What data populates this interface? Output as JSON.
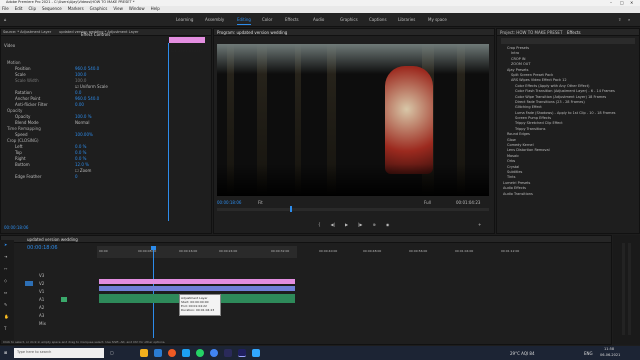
{
  "title": "Adobe Premiere Pro 2021 - C:\\Users\\Ajay\\Videos\\HOW TO MAKE PRESET *",
  "menu": [
    "File",
    "Edit",
    "Clip",
    "Sequence",
    "Markers",
    "Graphics",
    "View",
    "Window",
    "Help"
  ],
  "workspaces": [
    "Learning",
    "Assembly",
    "Editing",
    "Color",
    "Effects",
    "Audio",
    "Graphics",
    "Captions",
    "Libraries",
    "My space"
  ],
  "active_workspace": "Editing",
  "effect_controls": {
    "source_tab": "Source: * Adjustment Layer",
    "seq_tab": "updated version wedding * Adjustment Layer",
    "tab": "Effect Controls",
    "clip_label": "Adjustment Layer",
    "section": "Video",
    "rows": [
      {
        "label": "Motion",
        "value": ""
      },
      {
        "label": "Position",
        "value": "960.0   540.0"
      },
      {
        "label": "Scale",
        "value": "100.0"
      },
      {
        "label": "Scale Width",
        "value": "100.0"
      },
      {
        "label": "",
        "value": "Uniform Scale"
      },
      {
        "label": "Rotation",
        "value": "0.0"
      },
      {
        "label": "Anchor Point",
        "value": "960.0   540.0"
      },
      {
        "label": "Anti-flicker Filter",
        "value": "0.00"
      },
      {
        "label": "Opacity",
        "value": ""
      },
      {
        "label": "Opacity",
        "value": "100.0 %"
      },
      {
        "label": "Blend Mode",
        "value": "Normal"
      },
      {
        "label": "Time Remapping",
        "value": ""
      },
      {
        "label": "Speed",
        "value": "100.00%"
      },
      {
        "label": "Crop (CLOSING)",
        "value": ""
      },
      {
        "label": "Left",
        "value": "0.0 %"
      },
      {
        "label": "Top",
        "value": "0.0 %"
      },
      {
        "label": "Right",
        "value": "0.0 %"
      },
      {
        "label": "Bottom",
        "value": "12.0 %"
      },
      {
        "label": "",
        "value": "Zoom"
      },
      {
        "label": "Edge Feather",
        "value": "0"
      }
    ],
    "timecode": "00:00:18:06"
  },
  "program": {
    "tab": "Program: updated version wedding",
    "timecode": "00:00:18:06",
    "fit": "Fit",
    "quality": "Full",
    "duration": "00:01:04:23"
  },
  "project": {
    "tab": "Project: HOW TO MAKE PRESET",
    "effects_tab": "Effects",
    "items": [
      "Crop Presets",
      "Intro",
      "CROP IN",
      "ZOOM OUT",
      "Ajay Presets",
      "Split Screen Preset Pack",
      "ARS Wipes Video Effect Pack 12",
      "Color Effects (Apply with Any Other Effect)",
      "Color Flash Transition (Adjustment Layer) - 6 - 14 Frames",
      "Color Wipe Transition (Adjustment Layer) 18 Frames",
      "Direct Fade Transitions (23 - 28 Frames)",
      "Glitching Effect",
      "Luma Fade (Shadows) - Apply to 1st Clip - 10 - 18 Frames",
      "Screen Pump Effects",
      "Trippy Stretched Clip Effect",
      "Trippy Transitions",
      "Round Edges",
      "Glow",
      "Comedy Kernel",
      "Lens Distortion Removal",
      "Mosaic",
      "Orbs",
      "Crystal",
      "Subtitles",
      "Tints",
      "Lumetri Presets",
      "Audio Effects",
      "Audio Transitions"
    ]
  },
  "timeline": {
    "tab": "updated version wedding",
    "timecode": "00:00:18:06",
    "ruler": [
      "00:00",
      "00:00:08:00",
      "00:00:16:00",
      "00:00:24:00",
      "00:00:32:00",
      "00:00:40:00",
      "00:00:48:00",
      "00:00:56:00",
      "00:01:04:00",
      "00:01:12:00"
    ],
    "tracks": [
      "V3",
      "V2",
      "V1",
      "A1",
      "A2",
      "A3",
      "Mix"
    ],
    "clip_adjustment": "Adjustment Layer",
    "clip_video": "updated version wedding.mp4 [V]",
    "tooltip": [
      "Adjustment Layer",
      "Start: 00:00:00:00",
      "End: 00:01:04:22",
      "Duration: 00:01:04:23"
    ],
    "status": "Click to select, or click in empty space and drag to marquee select. Use Shift, Alt, and Ctrl for other options."
  },
  "taskbar": {
    "search_placeholder": "Type here to search",
    "weather": "29°C AQI 84",
    "time": "11:58",
    "date": "06-06-2021",
    "lang": "ENG"
  },
  "colors": {
    "accent": "#2d8ceb",
    "adjustment_clip": "#e38ee0",
    "video_clip": "#6f7fd8",
    "audio_clip": "#3aa96b",
    "playhead": "#2d8ceb"
  }
}
